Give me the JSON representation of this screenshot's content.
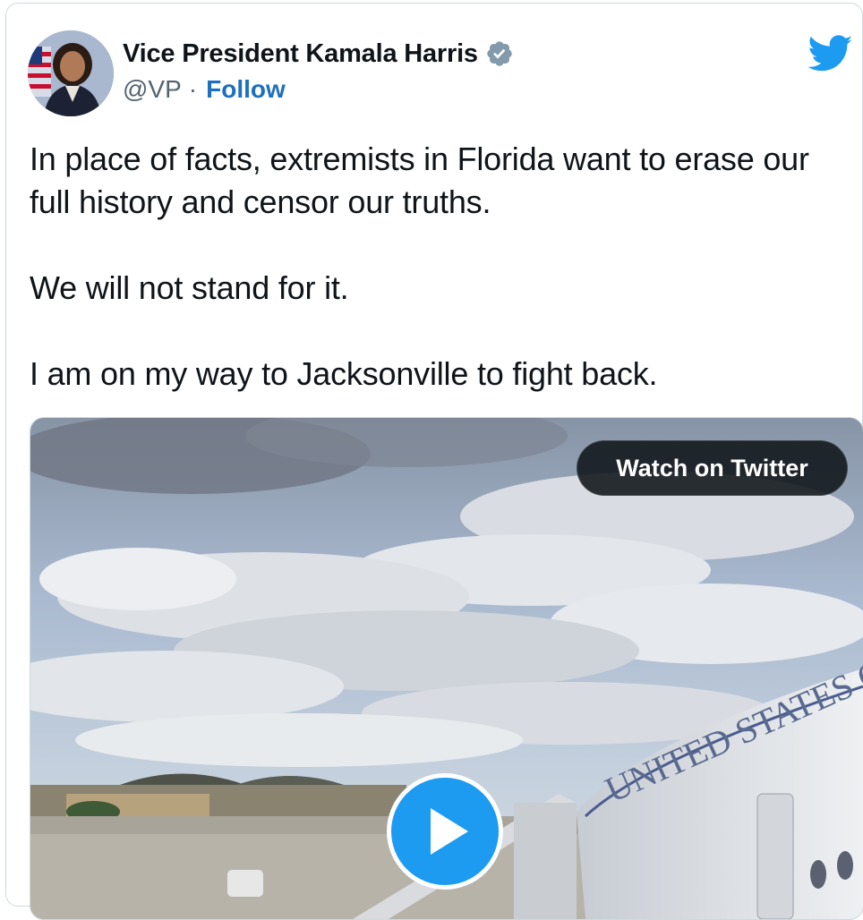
{
  "tweet": {
    "author_name": "Vice President Kamala Harris",
    "handle": "@VP",
    "separator": "·",
    "follow_label": "Follow",
    "paragraphs": [
      "In place of facts, extremists in Florida want to erase our full history and censor our truths.",
      "We will not stand for it.",
      "I am on my way to Jacksonville to fight back."
    ]
  },
  "media": {
    "watch_label": "Watch on Twitter",
    "plane_lettering": "UNITED STATES OF AMERICA"
  },
  "colors": {
    "accent": "#1d9bf0",
    "follow": "#1d6fc0",
    "verified": "#829aab",
    "text": "#0f1419",
    "secondary": "#536471"
  },
  "icons": [
    "verified-badge-icon",
    "twitter-bird-icon",
    "play-icon"
  ]
}
